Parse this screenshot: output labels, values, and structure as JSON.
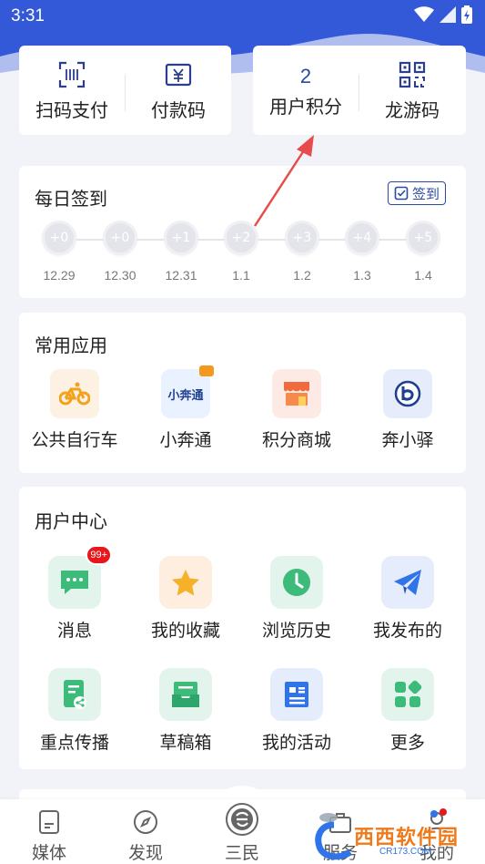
{
  "status_bar": {
    "time": "3:31"
  },
  "top_cards": {
    "scan_pay": "扫码支付",
    "pay_code": "付款码",
    "user_points_value": "2",
    "user_points": "用户积分",
    "dragon_code": "龙游码"
  },
  "checkin": {
    "title": "每日签到",
    "button": "签到",
    "days": [
      {
        "points": "+0",
        "date": "12.29"
      },
      {
        "points": "+0",
        "date": "12.30"
      },
      {
        "points": "+1",
        "date": "12.31"
      },
      {
        "points": "+2",
        "date": "1.1"
      },
      {
        "points": "+3",
        "date": "1.2"
      },
      {
        "points": "+4",
        "date": "1.3"
      },
      {
        "points": "+5",
        "date": "1.4"
      }
    ]
  },
  "apps": {
    "title": "常用应用",
    "items": [
      {
        "label": "公共自行车",
        "icon": "bicycle-icon"
      },
      {
        "label": "小奔通",
        "icon": "xiaobentong-icon",
        "tile_text": "小奔通"
      },
      {
        "label": "积分商城",
        "icon": "shop-icon"
      },
      {
        "label": "奔小驿",
        "icon": "benxiaoyi-icon"
      }
    ]
  },
  "user_center": {
    "title": "用户中心",
    "items": [
      {
        "label": "消息",
        "icon": "message-icon",
        "badge": "99+"
      },
      {
        "label": "我的收藏",
        "icon": "star-icon"
      },
      {
        "label": "浏览历史",
        "icon": "clock-icon"
      },
      {
        "label": "我发布的",
        "icon": "send-icon"
      },
      {
        "label": "重点传播",
        "icon": "share-doc-icon"
      },
      {
        "label": "草稿箱",
        "icon": "inbox-icon"
      },
      {
        "label": "我的活动",
        "icon": "activity-icon"
      },
      {
        "label": "更多",
        "icon": "more-grid-icon"
      }
    ]
  },
  "bottom_nav": {
    "items": [
      {
        "label": "媒体",
        "icon": "document-icon"
      },
      {
        "label": "发现",
        "icon": "compass-icon"
      },
      {
        "label": "三民",
        "icon": "sanmin-icon"
      },
      {
        "label": "服务",
        "icon": "service-icon"
      },
      {
        "label": "我的",
        "icon": "profile-icon"
      }
    ]
  },
  "colors": {
    "header_blue": "#2f5bd6",
    "accent_blue": "#2c4aa0",
    "badge_red": "#e8161d"
  },
  "watermark": {
    "text": "西西软件园",
    "sub": "CR173.COM"
  }
}
